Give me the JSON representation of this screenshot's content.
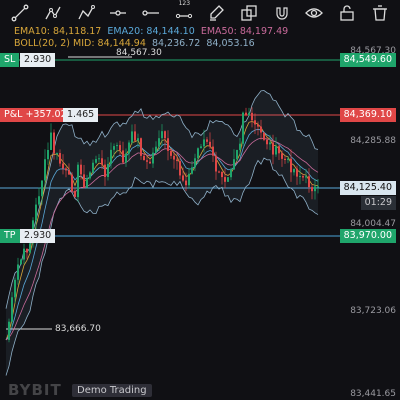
{
  "toolbar": {
    "icons": [
      "trendline-icon",
      "polyline-icon",
      "polyline-icon",
      "horizontal-line-icon",
      "horizontal-ray-icon",
      "numbered-line-icon",
      "brush-icon",
      "layer-icon",
      "magnet-icon",
      "eye-icon",
      "lock-icon",
      "trash-icon"
    ],
    "numbered_label": "123"
  },
  "indicators": {
    "ema10": "EMA10: 84,118.17",
    "ema20": "EMA20: 84,144.10",
    "ema50": "EMA50: 84,197.49",
    "boll": "BOLL(20, 2) MID: 84,144.94",
    "boll_upper": "84,236.72",
    "boll_lower": "84,053.16"
  },
  "positions": {
    "sl_label": "SL",
    "sl_qty": "2.930",
    "pnl_label": "P&L +357.02",
    "pnl_qty": "1.465",
    "tp_label": "TP",
    "tp_qty": "2.930"
  },
  "price_tags": {
    "sl_price": "84,549.60",
    "pnl_price": "84,369.10",
    "current_price": "84,125.40",
    "countdown": "01:29",
    "tp_price": "83,970.00"
  },
  "axis_labels": [
    "84,567.30",
    "84,285.88",
    "84,004.47",
    "83,723.06",
    "83,441.65"
  ],
  "annotations": {
    "high_marker": "84,567.30",
    "low_marker": "83,666.70"
  },
  "branding": {
    "watermark": "BYBIT",
    "demo_badge": "Demo Trading"
  },
  "colors": {
    "background": "#101014",
    "up": "#1fa56b",
    "down": "#e04747",
    "ema10": "#d7a63a",
    "ema20": "#5aa8d8",
    "ema50": "#c86a9a",
    "boll": "#8fb0c8",
    "sl_line": "#1fa56b",
    "pnl_line": "#e04747",
    "current_line": "#5aa8d8",
    "tp_line": "#4aa3d8"
  }
}
